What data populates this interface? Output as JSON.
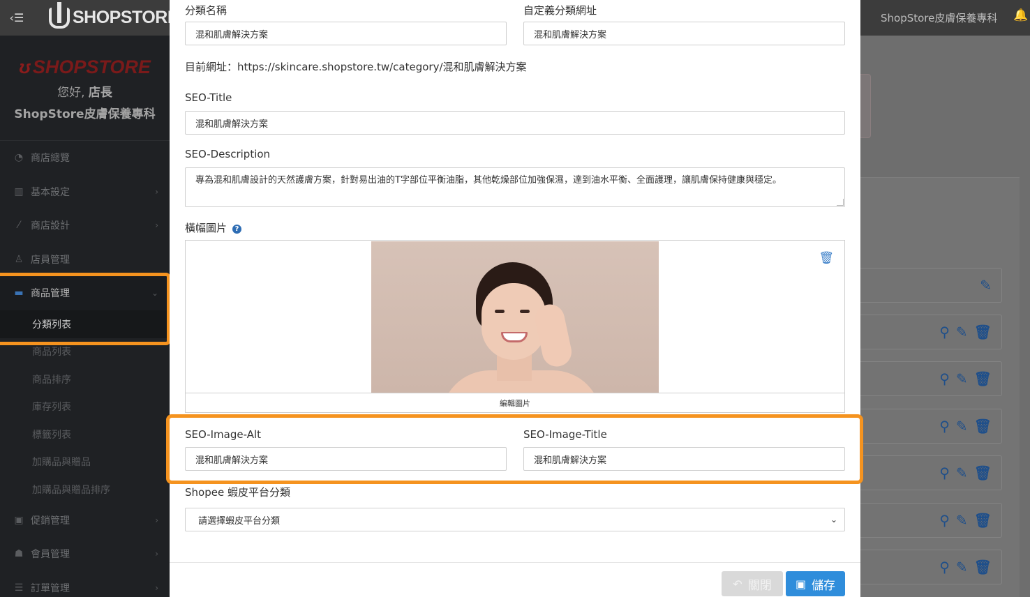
{
  "header": {
    "logo_text": "SHOPSTORE",
    "store_name": "ShopStore皮膚保養專科",
    "menu_icon": "menu-toggle-icon",
    "bell_icon": "bell-icon"
  },
  "sidebar": {
    "brand_logo": "SHOPSTORE",
    "greeting_prefix": "您好,",
    "greeting_name": "店長",
    "shop_name": "ShopStore皮膚保養專科",
    "items": [
      {
        "label": "商店總覽",
        "icon": "dashboard-icon"
      },
      {
        "label": "基本設定",
        "icon": "bank-icon"
      },
      {
        "label": "商店設計",
        "icon": "magic-wand-icon"
      },
      {
        "label": "店員管理",
        "icon": "user-lock-icon"
      },
      {
        "label": "商品管理",
        "icon": "cart-icon"
      },
      {
        "label": "促銷管理",
        "icon": "gift-icon"
      },
      {
        "label": "會員管理",
        "icon": "users-icon"
      },
      {
        "label": "訂單管理",
        "icon": "list-icon"
      }
    ],
    "sub_items": [
      "分類列表",
      "商品列表",
      "商品排序",
      "庫存列表",
      "標籤列表",
      "加購品與贈品",
      "加購品與贈品排序"
    ]
  },
  "form": {
    "category_name_label": "分類名稱",
    "category_name_value": "混和肌膚解決方案",
    "custom_url_label": "自定義分類網址",
    "custom_url_value": "混和肌膚解決方案",
    "current_url_label": "目前網址：",
    "current_url_value": "https://skincare.shopstore.tw/category/混和肌膚解決方案",
    "seo_title_label": "SEO-Title",
    "seo_title_value": "混和肌膚解決方案",
    "seo_desc_label": "SEO-Description",
    "seo_desc_value": "專為混和肌膚設計的天然護膚方案，針對易出油的T字部位平衡油脂，其他乾燥部位加強保濕，達到油水平衡、全面護理，讓肌膚保持健康與穩定。",
    "banner_label": "橫幅圖片",
    "edit_image_label": "編輯圖片",
    "seo_img_alt_label": "SEO-Image-Alt",
    "seo_img_alt_value": "混和肌膚解決方案",
    "seo_img_title_label": "SEO-Image-Title",
    "seo_img_title_value": "混和肌膚解決方案",
    "shopee_label": "Shopee 蝦皮平台分類",
    "shopee_selected": "請選擇蝦皮平台分類"
  },
  "buttons": {
    "close_label": "關閉",
    "save_label": "儲存"
  },
  "colors": {
    "highlight": "#f5931f",
    "primary": "#2f8ddb"
  }
}
